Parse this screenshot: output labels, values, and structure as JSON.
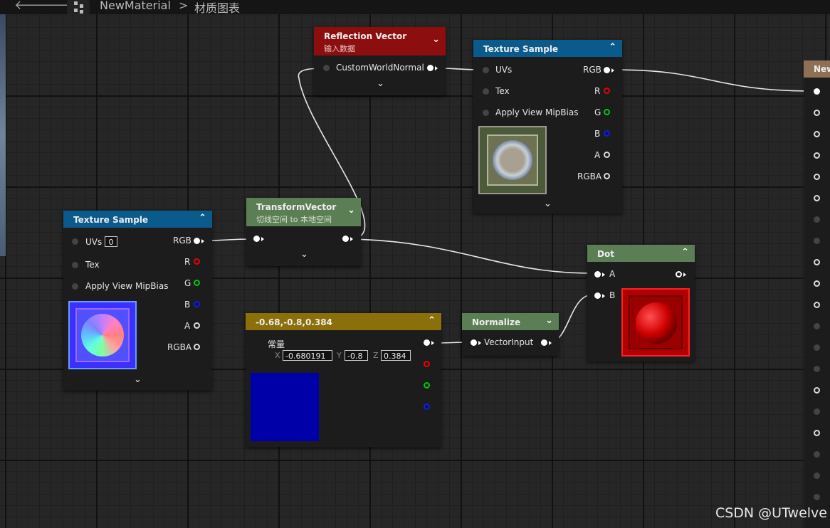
{
  "toolbar": {
    "back_glyph": "🡐",
    "forward_glyph": "🡒",
    "breadcrumb_material": "NewMaterial",
    "breadcrumb_separator": ">",
    "breadcrumb_graph": "材质图表"
  },
  "icons": {
    "back": "back-arrow-icon",
    "forward": "forward-arrow-icon",
    "graph": "node-graph-icon"
  },
  "nodes": {
    "reflection_vector": {
      "title": "Reflection Vector",
      "subtitle": "输入数据",
      "input_label": "CustomWorldNormal",
      "header_color": "#8c0e0e"
    },
    "texture_sample_top": {
      "title": "Texture Sample",
      "inputs": [
        "UVs",
        "Tex",
        "Apply View MipBias"
      ],
      "outputs": [
        "RGB",
        "R",
        "G",
        "B",
        "A",
        "RGBA"
      ],
      "header_color": "#0a5a8c"
    },
    "texture_sample_left": {
      "title": "Texture Sample",
      "inputs": [
        "UVs",
        "Tex",
        "Apply View MipBias"
      ],
      "uv_value": "0",
      "outputs": [
        "RGB",
        "R",
        "G",
        "B",
        "A",
        "RGBA"
      ],
      "header_color": "#0a5a8c"
    },
    "transform_vector": {
      "title": "TransformVector",
      "subtitle": "切线空间 to 本地空间",
      "header_color": "#5b7e55"
    },
    "constant3": {
      "title": "-0.68,-0.8,0.384",
      "label": "常量",
      "x_label": "X",
      "x_value": "-0.680191",
      "y_label": "Y",
      "y_value": "-0.8",
      "z_label": "Z",
      "z_value": "0.384",
      "header_color": "#8a6f0a",
      "preview_color": "#0000a8"
    },
    "normalize": {
      "title": "Normalize",
      "input_label": "VectorInput",
      "header_color": "#5b7e55"
    },
    "dot": {
      "title": "Dot",
      "input_a": "A",
      "input_b": "B",
      "header_color": "#5b7e55"
    },
    "result_node": {
      "title": "New",
      "header_color": "#8e7155"
    }
  },
  "watermark": "CSDN @UTwelve"
}
